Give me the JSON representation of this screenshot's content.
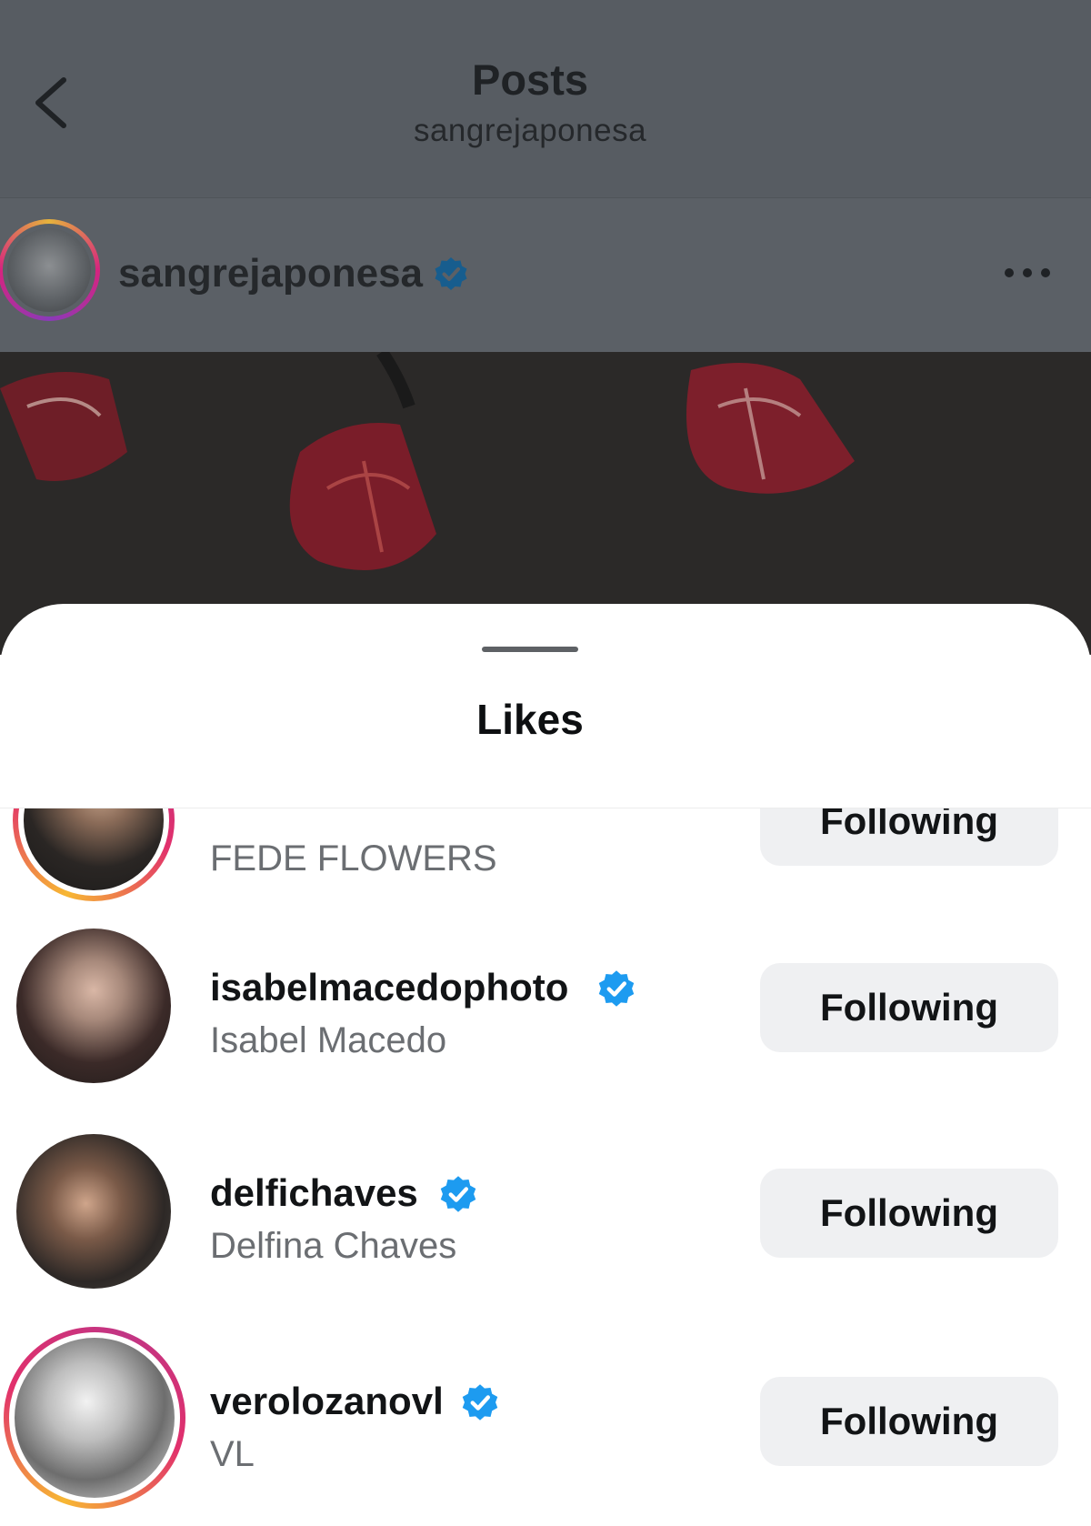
{
  "header": {
    "title": "Posts",
    "subtitle": "sangrejaponesa"
  },
  "post": {
    "username": "sangrejaponesa",
    "verified": true
  },
  "sheet": {
    "title": "Likes"
  },
  "likes": [
    {
      "username": "",
      "full_name": "FEDE FLOWERS",
      "verified": false,
      "button_label": "Following",
      "story_ring": true
    },
    {
      "username": "isabelmacedophoto",
      "full_name": "Isabel Macedo",
      "verified": true,
      "button_label": "Following",
      "story_ring": false
    },
    {
      "username": "delfichaves",
      "full_name": "Delfina Chaves",
      "verified": true,
      "button_label": "Following",
      "story_ring": false
    },
    {
      "username": "verolozanovl",
      "full_name": "VL",
      "verified": true,
      "button_label": "Following",
      "story_ring": true
    }
  ],
  "colors": {
    "verified_blue": "#1d9bf0",
    "button_bg": "#eff0f2",
    "story_ring_start": "#f7b733",
    "story_ring_end": "#e1306c"
  }
}
